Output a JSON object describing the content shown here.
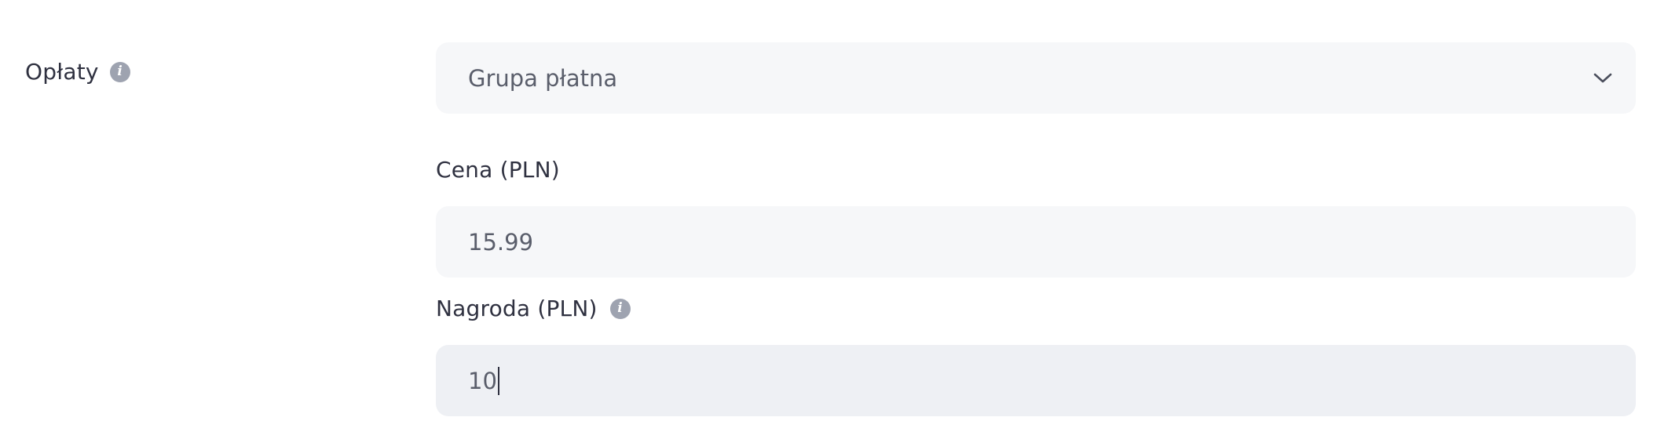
{
  "fees": {
    "label": "Opłaty",
    "info_icon": "info-icon"
  },
  "group_type_select": {
    "selected": "Grupa płatna",
    "icon": "chevron-down-icon"
  },
  "price_field": {
    "label": "Cena (PLN)",
    "value": "15.99"
  },
  "prize_field": {
    "label": "Nagroda (PLN)",
    "info_icon": "info-icon",
    "value": "10"
  },
  "colors": {
    "text": "#2f3140",
    "input_text": "#5a5e6b",
    "input_bg": "#f6f7f9",
    "focused_input_bg": "#eef0f4",
    "info_icon_bg": "#9ea3b0"
  }
}
